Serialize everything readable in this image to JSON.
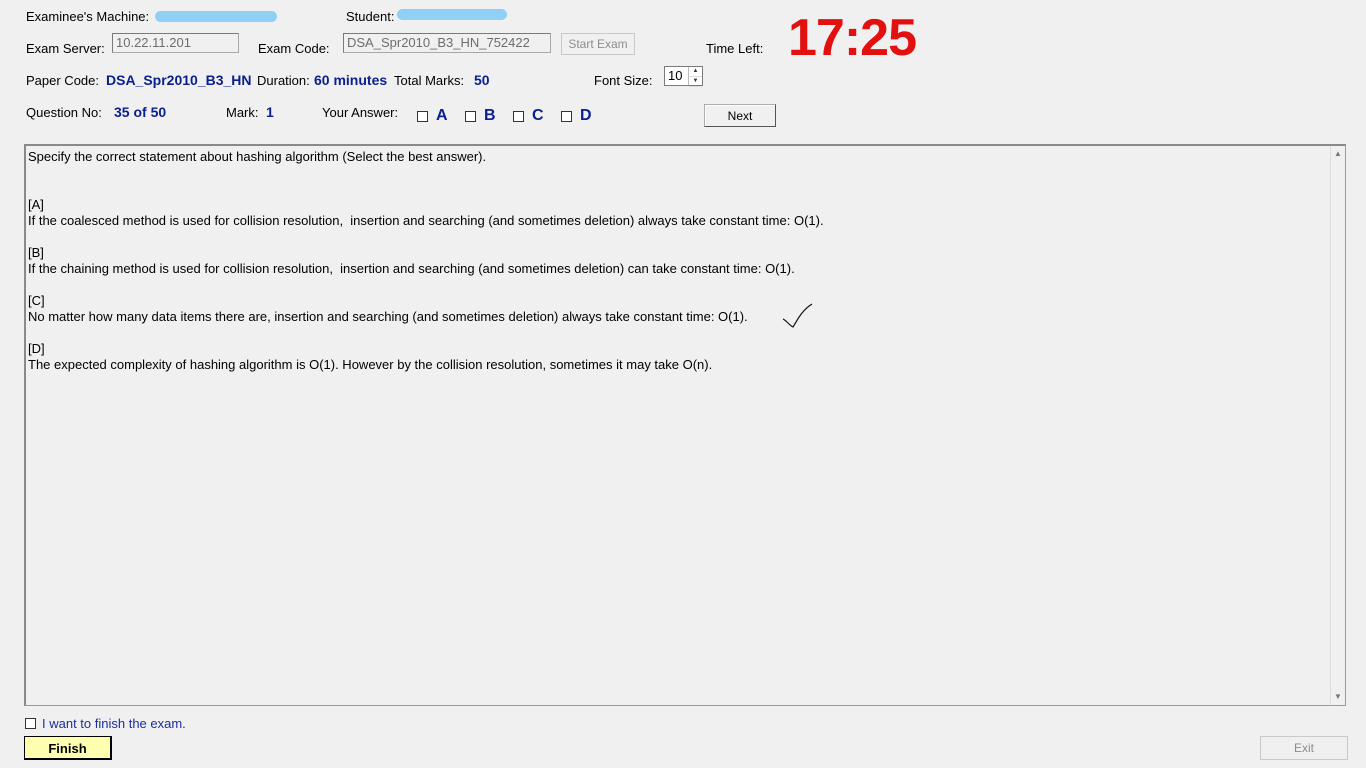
{
  "header": {
    "examinee_machine_label": "Examinee's Machine:",
    "student_label": "Student:",
    "exam_server_label": "Exam Server:",
    "exam_server_value": "10.22.11.201",
    "exam_code_label": "Exam Code:",
    "exam_code_value": "DSA_Spr2010_B3_HN_752422",
    "start_exam_label": "Start Exam",
    "time_left_label": "Time Left:",
    "time_left_value": "17:25",
    "paper_code_label": "Paper Code:",
    "paper_code_value": "DSA_Spr2010_B3_HN",
    "duration_label": "Duration:",
    "duration_value": "60 minutes",
    "total_marks_label": "Total Marks:",
    "total_marks_value": "50",
    "font_size_label": "Font Size:",
    "font_size_value": "10",
    "question_no_label": "Question No:",
    "question_no_value": "35 of 50",
    "mark_label": "Mark:",
    "mark_value": "1",
    "your_answer_label": "Your Answer:",
    "next_label": "Next"
  },
  "answers": [
    {
      "letter": "A",
      "checked": false
    },
    {
      "letter": "B",
      "checked": false
    },
    {
      "letter": "C",
      "checked": false
    },
    {
      "letter": "D",
      "checked": false
    }
  ],
  "question": {
    "prompt": "Specify the correct statement about hashing algorithm (Select the best answer).",
    "options": [
      {
        "tag": "[A]",
        "text": "If the coalesced method is used for collision resolution,  insertion and searching (and sometimes deletion) always take constant time: O(1)."
      },
      {
        "tag": "[B]",
        "text": "If the chaining method is used for collision resolution,  insertion and searching (and sometimes deletion) can take constant time: O(1)."
      },
      {
        "tag": "[C]",
        "text": "No matter how many data items there are, insertion and searching (and sometimes deletion) always take constant time: O(1)."
      },
      {
        "tag": "[D]",
        "text": "The expected complexity of hashing algorithm is O(1). However by the collision resolution, sometimes it may take O(n)."
      }
    ]
  },
  "footer": {
    "finish_check_label": "I want to finish the exam.",
    "finish_label": "Finish",
    "exit_label": "Exit"
  },
  "colors": {
    "accent_blue": "#0a1f8f",
    "timer_red": "#e31010",
    "finish_yellow": "#ffffb0"
  },
  "icons": {
    "annotation": "checkmark-icon",
    "spin_up": "spin-up-icon",
    "spin_down": "spin-down-icon",
    "scroll_up": "scroll-up-icon",
    "scroll_down": "scroll-down-icon"
  }
}
